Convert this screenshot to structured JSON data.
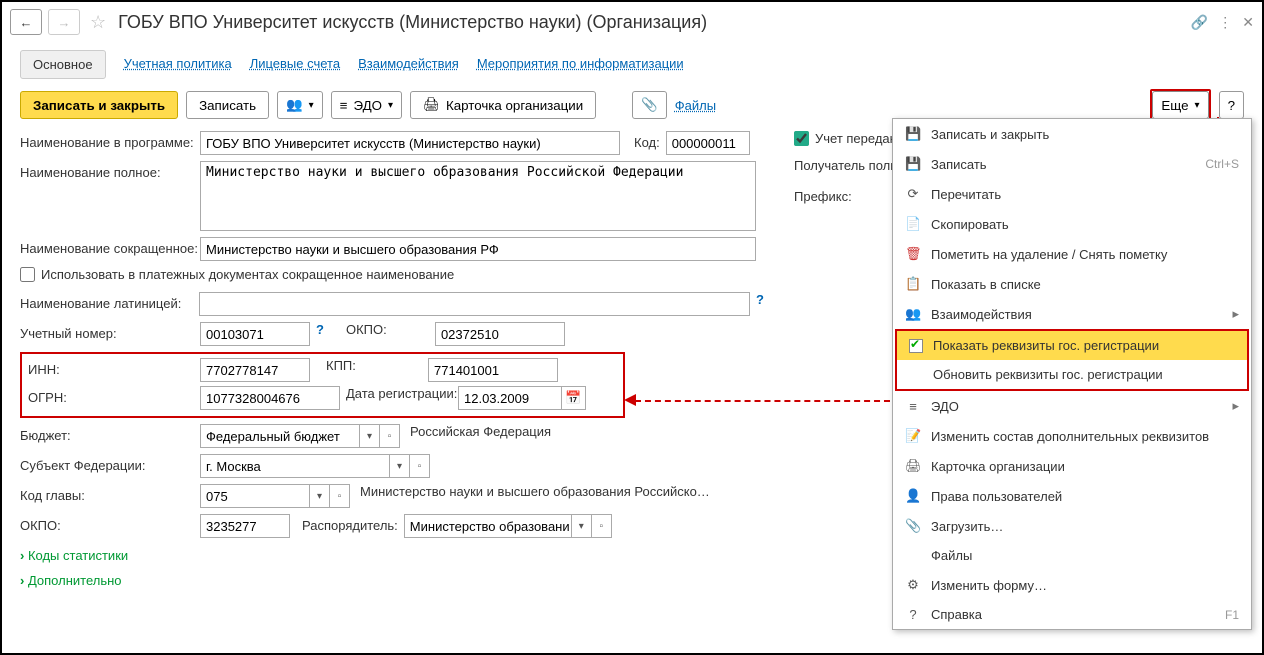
{
  "header": {
    "title": "ГОБУ ВПО Университет искусств (Министерство науки) (Организация)"
  },
  "nav": {
    "main": "Основное",
    "links": [
      "Учетная политика",
      "Лицевые счета",
      "Взаимодействия",
      "Мероприятия по информатизации"
    ]
  },
  "toolbar": {
    "save_close": "Записать и закрыть",
    "save": "Записать",
    "edo": "ЭДО",
    "card": "Карточка организации",
    "files": "Файлы",
    "more": "Еще",
    "help": "?"
  },
  "labels": {
    "name_prog": "Наименование в программе:",
    "name_full": "Наименование полное:",
    "name_short": "Наименование сокращенное:",
    "use_short": "Использовать в платежных документах сокращенное наименование",
    "name_lat": "Наименование латиницей:",
    "acc_num": "Учетный номер:",
    "okpo": "ОКПО:",
    "inn": "ИНН:",
    "kpp": "КПП:",
    "ogrn": "ОГРН:",
    "reg_date": "Дата регистрации:",
    "budget": "Бюджет:",
    "subject": "Субъект Федерации:",
    "head_code": "Код главы:",
    "okpo2": "ОКПО:",
    "distributor": "Распорядитель:",
    "stat_codes": "Коды статистики",
    "extra": "Дополнительно",
    "uchet_pered": "Учет передан",
    "recipient": "Получатель полном",
    "prefix": "Префикс:"
  },
  "values": {
    "name_prog": "ГОБУ ВПО Университет искусств (Министерство науки)",
    "code_lbl": "Код:",
    "code": "000000011",
    "name_full": "Министерство науки и высшего образования Российской Федерации",
    "name_short": "Министерство науки и высшего образования РФ",
    "name_lat": "",
    "acc_num": "00103071",
    "okpo": "02372510",
    "inn": "7702778147",
    "kpp": "771401001",
    "ogrn": "1077328004676",
    "reg_date": "12.03.2009",
    "budget": "Федеральный бюджет",
    "budget_txt": "Российская Федерация",
    "subject": "г. Москва",
    "head_code": "075",
    "head_txt": "Министерство науки и высшего образования Российской Феде…",
    "okpo2": "3235277",
    "distributor": "Министерство образовани"
  },
  "menu": {
    "items": [
      {
        "icon": "save-close",
        "label": "Записать и закрыть"
      },
      {
        "icon": "save",
        "label": "Записать",
        "shortcut": "Ctrl+S"
      },
      {
        "icon": "refresh",
        "label": "Перечитать"
      },
      {
        "icon": "copy",
        "label": "Скопировать"
      },
      {
        "icon": "delete",
        "label": "Пометить на удаление / Снять пометку"
      },
      {
        "icon": "list",
        "label": "Показать в списке"
      },
      {
        "icon": "interact",
        "label": "Взаимодействия",
        "sub": true
      }
    ],
    "red_group": [
      {
        "check": true,
        "label": "Показать реквизиты гос. регистрации"
      },
      {
        "check": false,
        "label": "Обновить реквизиты гос. регистрации"
      }
    ],
    "items2": [
      {
        "icon": "edo",
        "label": "ЭДО",
        "sub": true
      },
      {
        "icon": "edit-list",
        "label": "Изменить состав дополнительных реквизитов"
      },
      {
        "icon": "print",
        "label": "Карточка организации"
      },
      {
        "icon": "users",
        "label": "Права пользователей"
      },
      {
        "icon": "clip",
        "label": "Загрузить…"
      },
      {
        "icon": "blank",
        "label": "Файлы"
      },
      {
        "icon": "form",
        "label": "Изменить форму…"
      },
      {
        "icon": "help",
        "label": "Справка",
        "shortcut": "F1"
      }
    ]
  }
}
